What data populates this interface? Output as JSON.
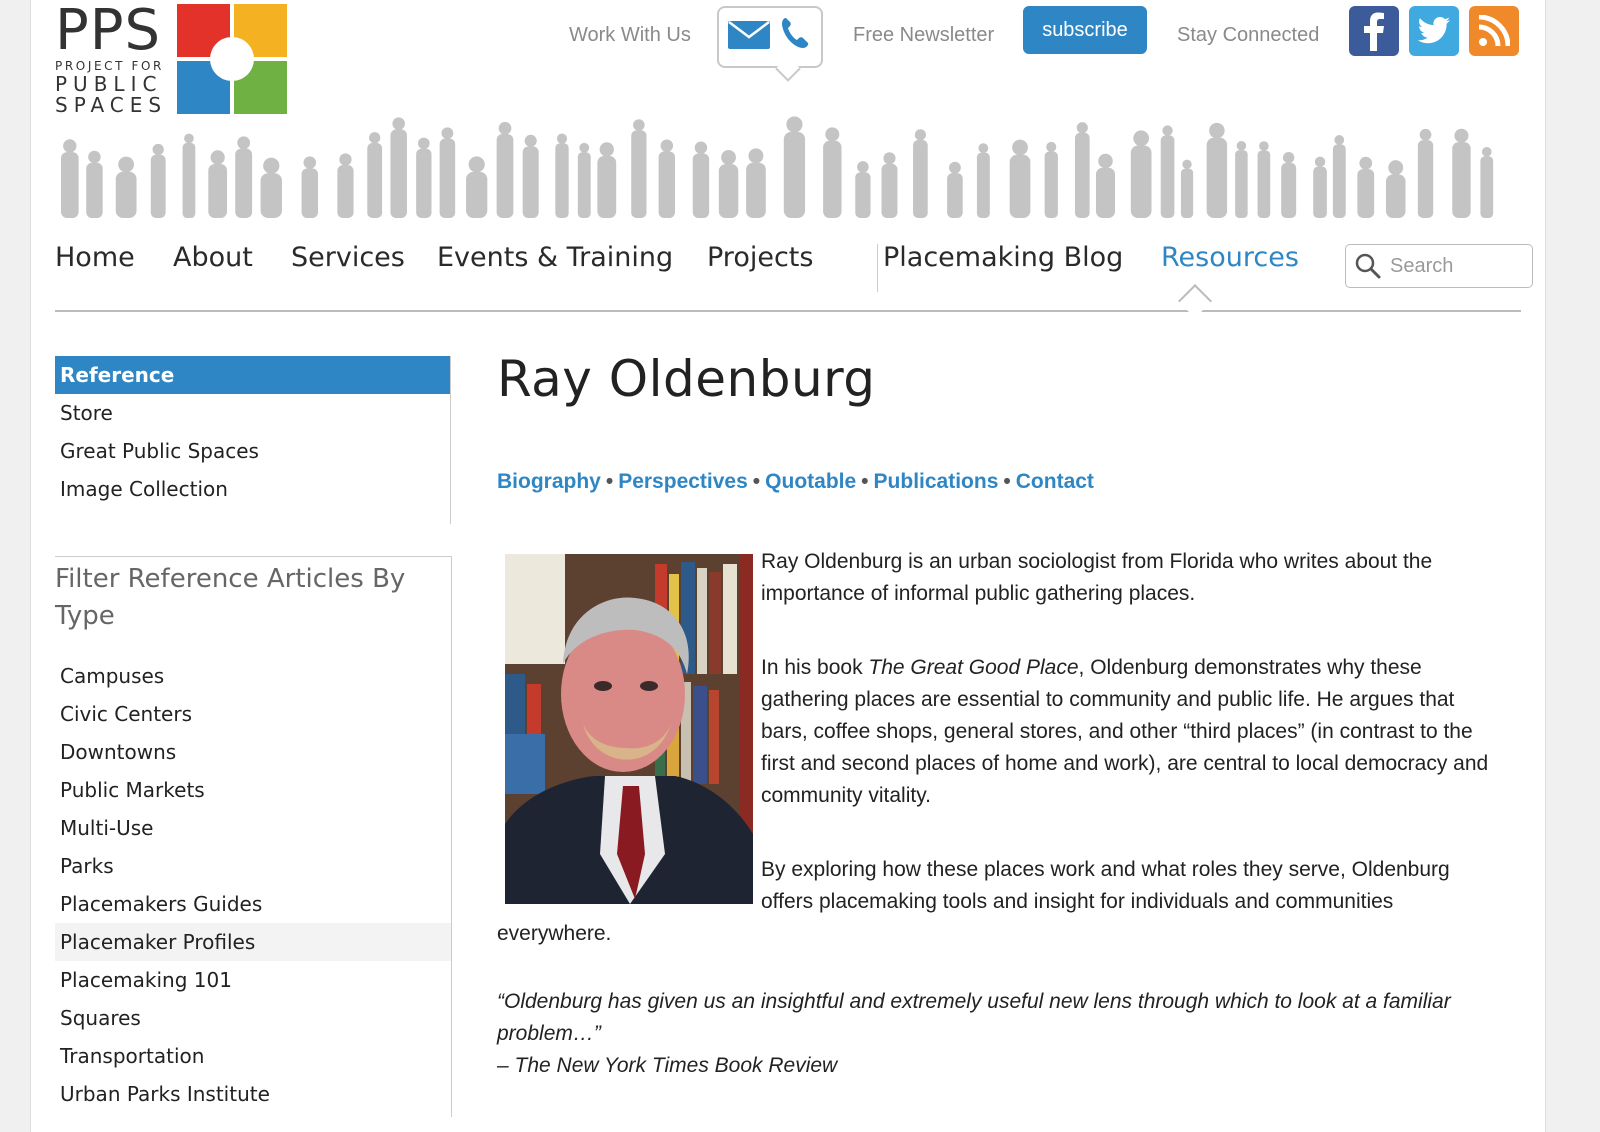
{
  "logo": {
    "name": "PPS",
    "line1": "PROJECT FOR",
    "line2": "PUBLIC",
    "line3": "SPACES",
    "colors": [
      "#e2322a",
      "#f4b223",
      "#2f86c4",
      "#6fb142"
    ]
  },
  "header": {
    "work_with_us": "Work With Us",
    "free_newsletter": "Free Newsletter",
    "subscribe": "subscribe",
    "stay_connected": "Stay Connected",
    "social": [
      "facebook-icon",
      "twitter-icon",
      "rss-icon"
    ]
  },
  "nav": {
    "items": [
      "Home",
      "About",
      "Services",
      "Events & Training",
      "Projects",
      "Placemaking Blog",
      "Resources"
    ],
    "active": "Resources",
    "search_placeholder": "Search"
  },
  "sidebar": {
    "items": [
      "Reference",
      "Store",
      "Great Public Spaces",
      "Image Collection"
    ],
    "active": "Reference",
    "filter_title": "Filter Reference Articles By Type",
    "filters": [
      "Campuses",
      "Civic Centers",
      "Downtowns",
      "Public Markets",
      "Multi-Use",
      "Parks",
      "Placemakers Guides",
      "Placemaker Profiles",
      "Placemaking 101",
      "Squares",
      "Transportation",
      "Urban Parks Institute"
    ]
  },
  "main": {
    "title": "Ray Oldenburg",
    "subnav": [
      "Biography",
      "Perspectives",
      "Quotable",
      "Publications",
      "Contact"
    ],
    "p1": "Ray Oldenburg is an urban sociologist from Florida who writes about the importance of informal public gathering places.",
    "p2_pre": "In his book ",
    "p2_book": "The Great Good Place",
    "p2_post": ", Oldenburg demonstrates why these gathering places are essential to community and public life. He argues that bars, coffee shops, general stores, and other “third places” (in contrast to the first and second places of home and work), are central to local democracy and community vitality.",
    "p3": "By exploring how these places work and what roles they serve, Oldenburg offers placemaking tools and insight for individuals and communities everywhere.",
    "quote": "“Oldenburg has given us an insightful and extremely useful new lens through which to look at a familiar problem…”",
    "quote_source": "– The New York Times Book Review"
  }
}
